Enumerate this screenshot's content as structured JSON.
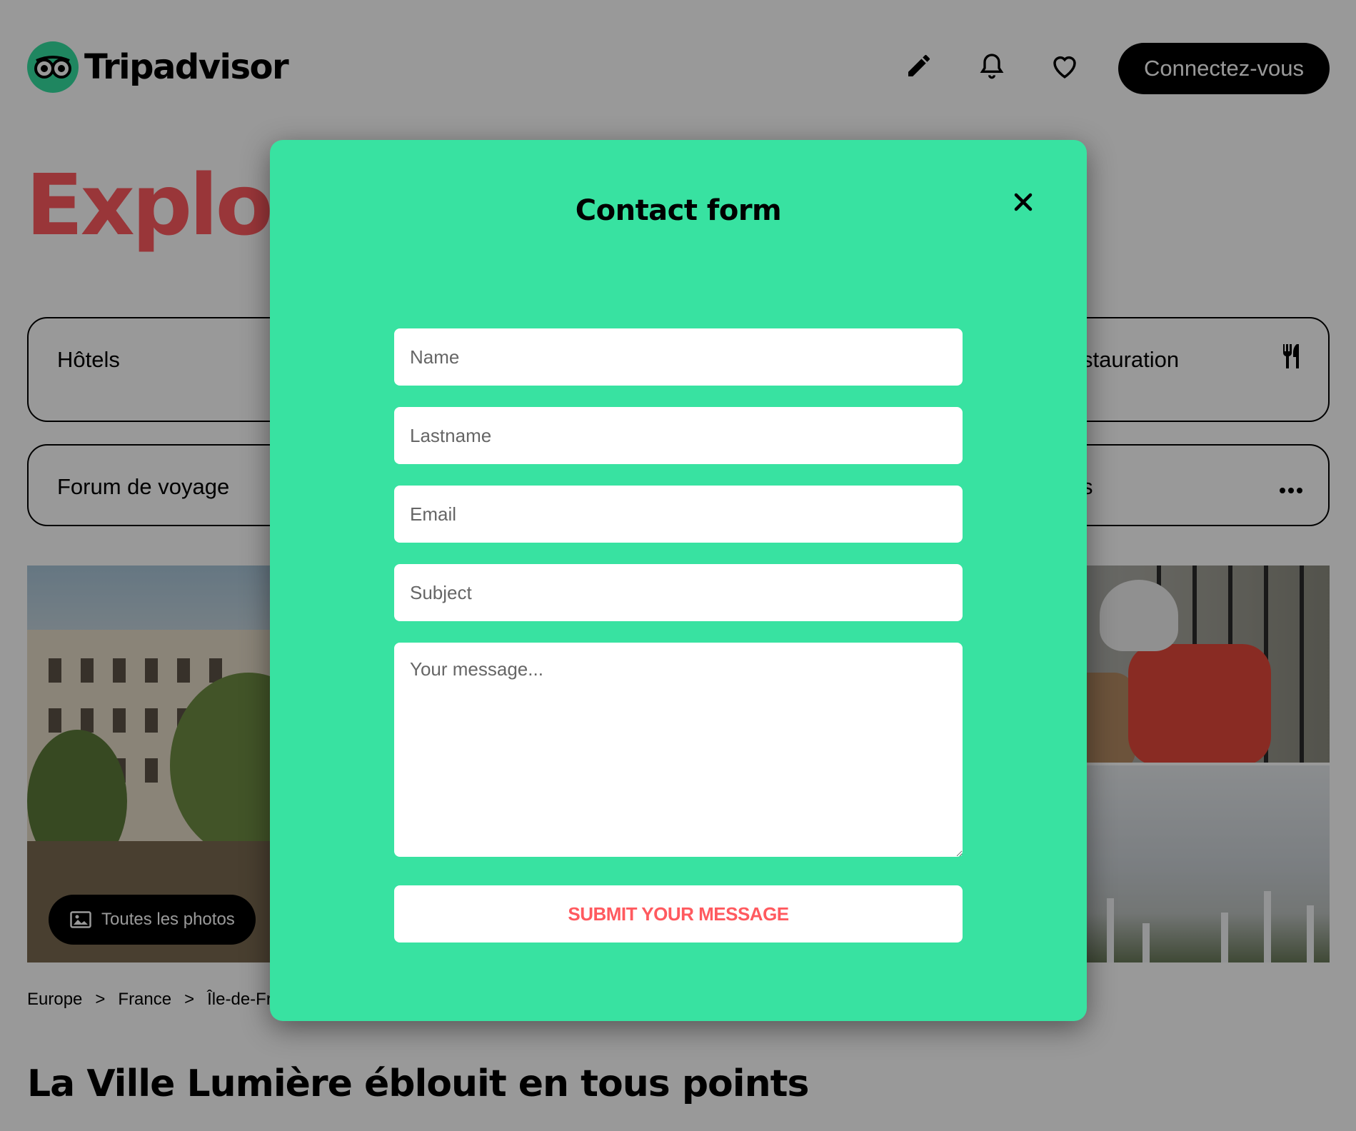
{
  "header": {
    "brand": "Tripadvisor",
    "login_label": "Connectez-vous",
    "icons": [
      "pencil-icon",
      "bell-icon",
      "heart-icon"
    ]
  },
  "hero": {
    "title_visible": "Explore"
  },
  "categories": [
    {
      "label": "Hôtels"
    },
    {
      "label": "Forum de voyage"
    },
    {
      "label": "stauration",
      "icon": "cutlery-icon"
    },
    {
      "label": "s",
      "icon": "more-icon"
    }
  ],
  "photos": {
    "all_photos_label": "Toutes les photos"
  },
  "breadcrumb": {
    "items": [
      "Europe",
      "France",
      "Île-de-Fra"
    ],
    "separator": ">"
  },
  "headline": "La Ville Lumière éblouit en tous points",
  "modal": {
    "title": "Contact form",
    "fields": {
      "name_placeholder": "Name",
      "lastname_placeholder": "Lastname",
      "email_placeholder": "Email",
      "subject_placeholder": "Subject",
      "message_placeholder": "Your message..."
    },
    "submit_label": "SUBMIT YOUR MESSAGE"
  },
  "colors": {
    "brand_green": "#34e0a1",
    "modal_bg": "#38e2a1",
    "accent_red": "#ff5a5f",
    "overlay": "rgba(0,0,0,0.4)"
  }
}
